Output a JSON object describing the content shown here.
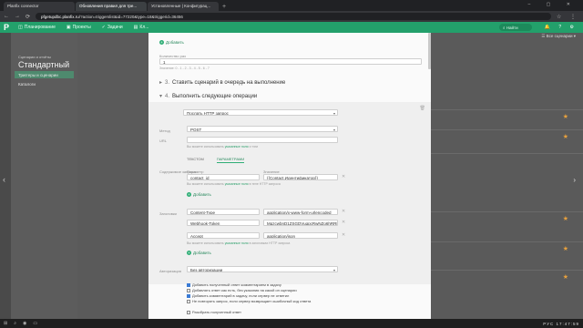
{
  "browser": {
    "tabs": [
      "Planfix connector",
      "Обновления правил для тре...",
      "Установленные | Конфигурац..."
    ],
    "new_tab": "+",
    "window_controls": "– ▢ ✕",
    "url_host": "pfgetupdbc.planfix.ru",
    "url_path": "/?action=triggerslist&id=77220&type=18&triggerid=36456"
  },
  "appbar": {
    "nav": [
      {
        "icon": "◫",
        "label": "Планирование"
      },
      {
        "icon": "▣",
        "label": "Проекты"
      },
      {
        "icon": "✓",
        "label": "Задачи"
      },
      {
        "icon": "▤",
        "label": "Кл..."
      }
    ],
    "search_label": "Найти",
    "right_icons": "🔔 ? ⚙"
  },
  "sidepanel": {
    "crumb": "Сценарии и отчёты",
    "title": "Стандартный",
    "items": [
      "Триггеры и сценарии",
      "Каталоги"
    ]
  },
  "background": {
    "filter_label": "Все сценарии"
  },
  "modal": {
    "add_label": "Добавить",
    "exec_label": "Количество раз",
    "exec_value": "1",
    "exec_hint": "Значение: 0 - 1 - 2 - 3 - 4 - 5 - 6 - 7",
    "section3": {
      "num": "3.",
      "label": "Ставить сценарий в очередь на выполнение"
    },
    "section4": {
      "num": "4.",
      "label": "Выполнить следующие операции"
    },
    "operation": "Послать HTTP запрос",
    "method_label": "Метод",
    "method_value": "POST",
    "url_label": "URL",
    "url_value": "",
    "url_hint_pre": "Вы можете использовать",
    "url_hint_link": "указанные поля",
    "url_hint_post": "и тэги",
    "body_tabs": [
      "ТЕКСТОМ",
      "ПАРАМЕТРАМИ"
    ],
    "body_label": "Содержимое запроса",
    "param_label": "Параметр",
    "value_label": "Значение",
    "param_name": "contact_id",
    "param_value": "{{Contact.Идентификатор}}",
    "body_hint_pre": "Вы можете использовать",
    "body_hint_link": "указанные поля",
    "body_hint_post": "в теле HTTP запроса",
    "headers_label": "Заголовки",
    "headers": [
      {
        "name": "Content-Type",
        "value": "application/x-www-form-urlencoded"
      },
      {
        "name": "Webhook-Token",
        "value": "MqzcwbnD1ZSGDVuqpcRwNZo6hRRE"
      },
      {
        "name": "Accept",
        "value": "application/json"
      }
    ],
    "headers_hint_pre": "Вы можете использовать",
    "headers_hint_link": "указанные поля",
    "headers_hint_post": "в заголовках HTTP запроса",
    "auth_label": "Авторизация",
    "auth_value": "Без авторизации",
    "checkboxes": [
      {
        "label": "Добавить полученный ответ комментарием в задачу",
        "checked": true
      },
      {
        "label": "Добавлять ответ как есть, без указания на какой он сценарии",
        "checked": false
      },
      {
        "label": "Добавить комментарий в задачу, если сервер не ответил",
        "checked": true
      },
      {
        "label": "Не повторять запрос, если сервер возвращает ошибочный код ответа",
        "checked": false
      }
    ],
    "parse_label": "Разобрать полученный ответ"
  },
  "taskbar": {
    "lang": "РУС",
    "time": "17:47:59"
  }
}
